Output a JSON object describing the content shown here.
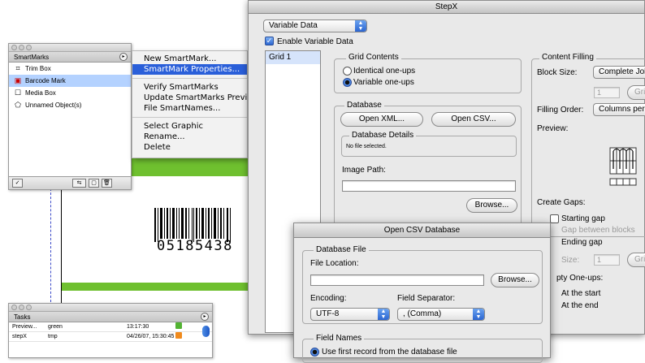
{
  "barcode": {
    "number": "05185438"
  },
  "smartmarks_palette": {
    "title": "SmartMarks",
    "items": [
      {
        "label": "Trim Box",
        "icon": "trim-box-icon",
        "selected": false
      },
      {
        "label": "Barcode Mark",
        "icon": "barcode-mark-icon",
        "selected": true
      },
      {
        "label": "Media Box",
        "icon": "media-box-icon",
        "selected": false
      },
      {
        "label": "Unnamed Object(s)",
        "icon": "object-icon",
        "selected": false
      }
    ]
  },
  "context_menu": {
    "items": [
      "New SmartMark...",
      "SmartMark Properties...",
      "Verify SmartMarks",
      "Update SmartMarks Preview",
      "File SmartNames...",
      "Select Graphic",
      "Rename...",
      "Delete"
    ],
    "highlighted_index": 1
  },
  "stepx": {
    "title": "StepX",
    "mode_popup": "Variable Data",
    "enable_label": "Enable Variable Data",
    "grids": [
      "Grid 1"
    ],
    "grid_contents": {
      "title": "Grid Contents",
      "identical": "Identical one-ups",
      "variable": "Variable one-ups",
      "selected": "variable"
    },
    "database": {
      "title": "Database",
      "open_xml": "Open XML...",
      "open_csv": "Open CSV...",
      "details_title": "Database Details",
      "details_text": "No file selected.",
      "image_path_label": "Image Path:",
      "image_path_value": "",
      "browse": "Browse..."
    },
    "content_filling": {
      "title": "Content Filling",
      "block_size_label": "Block Size:",
      "block_size_value": "Complete Jobs",
      "block_count": "1",
      "grid_btn": "Grid",
      "filling_order_label": "Filling Order:",
      "filling_order_value": "Columns per",
      "preview_label": "Preview:",
      "create_gaps_label": "Create Gaps:",
      "starting_gap": "Starting gap",
      "gap_between": "Gap between blocks",
      "ending_gap": "Ending gap",
      "size_label": "Size:",
      "size_value": "1",
      "size_grid_btn": "Grid",
      "empty_oneups_label": "pty One-ups:",
      "at_start": "At the start",
      "at_end": "At the end"
    }
  },
  "csv_dialog": {
    "title": "Open CSV Database",
    "database_file_title": "Database File",
    "file_location_label": "File Location:",
    "file_location_value": "",
    "browse": "Browse...",
    "encoding_label": "Encoding:",
    "encoding_value": "UTF-8",
    "separator_label": "Field Separator:",
    "separator_value": ", (Comma)",
    "field_names_title": "Field Names",
    "use_first_record": "Use first record from the database file"
  },
  "tasks_palette": {
    "title": "Tasks",
    "rows": [
      {
        "name": "Preview...",
        "param": "green",
        "time": "13:17:30",
        "status_color": "#52b332"
      },
      {
        "name": "stepX",
        "param": "tmp",
        "time": "04/26/07, 15:30:45",
        "status_color": "#f08a1c"
      }
    ]
  },
  "colors": {
    "accent": "#2a5fd9",
    "green_strip": "#6fc02f"
  }
}
